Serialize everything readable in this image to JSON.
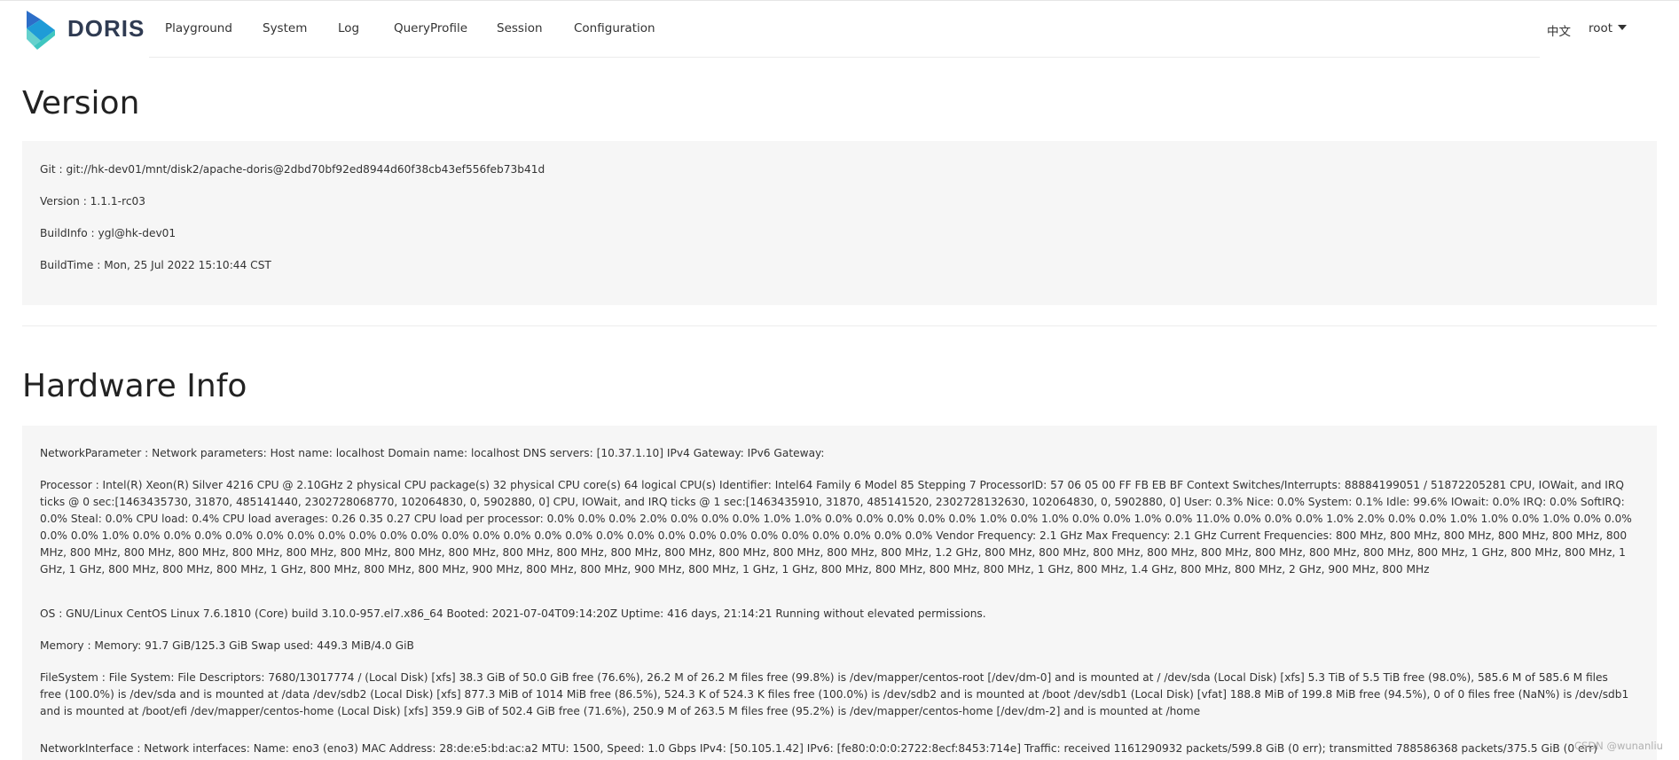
{
  "header": {
    "brand": "DORIS",
    "nav": [
      {
        "label": "Playground"
      },
      {
        "label": "System"
      },
      {
        "label": "Log"
      },
      {
        "label": "QueryProfile"
      },
      {
        "label": "Session"
      },
      {
        "label": "Configuration"
      }
    ],
    "language": "中文",
    "user": "root"
  },
  "version": {
    "title": "Version",
    "items": [
      {
        "text": "Git : git://hk-dev01/mnt/disk2/apache-doris@2dbd70bf92ed8944d60f38cb43ef556feb73b41d"
      },
      {
        "text": "Version : 1.1.1-rc03"
      },
      {
        "text": "BuildInfo : ygl@hk-dev01"
      },
      {
        "text": "BuildTime : Mon, 25 Jul 2022 15:10:44 CST"
      }
    ]
  },
  "hardware": {
    "title": "Hardware Info",
    "items": [
      {
        "text": "NetworkParameter : Network parameters: Host name: localhost Domain name: localhost DNS servers: [10.37.1.10] IPv4 Gateway: IPv6 Gateway:"
      },
      {
        "text": "Processor : Intel(R) Xeon(R) Silver 4216 CPU @ 2.10GHz 2 physical CPU package(s) 32 physical CPU core(s) 64 logical CPU(s) Identifier: Intel64 Family 6 Model 85 Stepping 7 ProcessorID: 57 06 05 00 FF FB EB BF Context Switches/Interrupts: 88884199051 / 51872205281 CPU, IOWait, and IRQ ticks @ 0 sec:[1463435730, 31870, 485141440, 2302728068770, 102064830, 0, 5902880, 0] CPU, IOWait, and IRQ ticks @ 1 sec:[1463435910, 31870, 485141520, 2302728132630, 102064830, 0, 5902880, 0] User: 0.3% Nice: 0.0% System: 0.1% Idle: 99.6% IOwait: 0.0% IRQ: 0.0% SoftIRQ: 0.0% Steal: 0.0% CPU load: 0.4% CPU load averages: 0.26 0.35 0.27 CPU load per processor: 0.0% 0.0% 0.0% 2.0% 0.0% 0.0% 0.0% 1.0% 1.0% 0.0% 0.0% 0.0% 0.0% 0.0% 1.0% 0.0% 1.0% 0.0% 0.0% 1.0% 0.0% 11.0% 0.0% 0.0% 0.0% 1.0% 2.0% 0.0% 0.0% 1.0% 1.0% 0.0% 1.0% 0.0% 0.0% 0.0% 0.0% 1.0% 0.0% 0.0% 0.0% 0.0% 0.0% 0.0% 0.0% 0.0% 0.0% 0.0% 0.0% 0.0% 0.0% 0.0% 0.0% 0.0% 0.0% 0.0% 0.0% 0.0% 0.0% 0.0% 0.0% 0.0% 0.0% 0.0% Vendor Frequency: 2.1 GHz Max Frequency: 2.1 GHz Current Frequencies: 800 MHz, 800 MHz, 800 MHz, 800 MHz, 800 MHz, 800 MHz, 800 MHz, 800 MHz, 800 MHz, 800 MHz, 800 MHz, 800 MHz, 800 MHz, 800 MHz, 800 MHz, 800 MHz, 800 MHz, 800 MHz, 800 MHz, 800 MHz, 800 MHz, 800 MHz, 1.2 GHz, 800 MHz, 800 MHz, 800 MHz, 800 MHz, 800 MHz, 800 MHz, 800 MHz, 800 MHz, 800 MHz, 1 GHz, 800 MHz, 800 MHz, 1 GHz, 1 GHz, 800 MHz, 800 MHz, 800 MHz, 1 GHz, 800 MHz, 800 MHz, 800 MHz, 900 MHz, 800 MHz, 800 MHz, 900 MHz, 800 MHz, 1 GHz, 1 GHz, 800 MHz, 800 MHz, 800 MHz, 800 MHz, 1 GHz, 800 MHz, 1.4 GHz, 800 MHz, 800 MHz, 2 GHz, 900 MHz, 800 MHz"
      },
      {
        "text": "OS : GNU/Linux CentOS Linux 7.6.1810 (Core) build 3.10.0-957.el7.x86_64 Booted: 2021-07-04T09:14:20Z Uptime: 416 days, 21:14:21 Running without elevated permissions."
      },
      {
        "text": "Memory : Memory: 91.7 GiB/125.3 GiB Swap used: 449.3 MiB/4.0 GiB"
      },
      {
        "text": "FileSystem : File System: File Descriptors: 7680/13017774 / (Local Disk) [xfs] 38.3 GiB of 50.0 GiB free (76.6%), 26.2 M of 26.2 M files free (99.8%) is /dev/mapper/centos-root [/dev/dm-0] and is mounted at / /dev/sda (Local Disk) [xfs] 5.3 TiB of 5.5 TiB free (98.0%), 585.6 M of 585.6 M files free (100.0%) is /dev/sda and is mounted at /data /dev/sdb2 (Local Disk) [xfs] 877.3 MiB of 1014 MiB free (86.5%), 524.3 K of 524.3 K files free (100.0%) is /dev/sdb2 and is mounted at /boot /dev/sdb1 (Local Disk) [vfat] 188.8 MiB of 199.8 MiB free (94.5%), 0 of 0 files free (NaN%) is /dev/sdb1 and is mounted at /boot/efi /dev/mapper/centos-home (Local Disk) [xfs] 359.9 GiB of 502.4 GiB free (71.6%), 250.9 M of 263.5 M files free (95.2%) is /dev/mapper/centos-home [/dev/dm-2] and is mounted at /home"
      },
      {
        "text": "NetworkInterface : Network interfaces: Name: eno3 (eno3) MAC Address: 28:de:e5:bd:ac:a2 MTU: 1500, Speed: 1.0 Gbps IPv4: [50.105.1.42] IPv6: [fe80:0:0:0:2722:8ecf:8453:714e] Traffic: received 1161290932 packets/599.8 GiB (0 err); transmitted 788586368 packets/375.5 GiB (0 err)"
      }
    ]
  },
  "watermark": "CSDN @wunanliu",
  "colors": {
    "logo_dark": "#2d6ec8",
    "logo_light": "#3fc6c0",
    "logo_mid": "#1e9bd7",
    "panel_bg": "#f6f6f6",
    "text": "#333333"
  }
}
